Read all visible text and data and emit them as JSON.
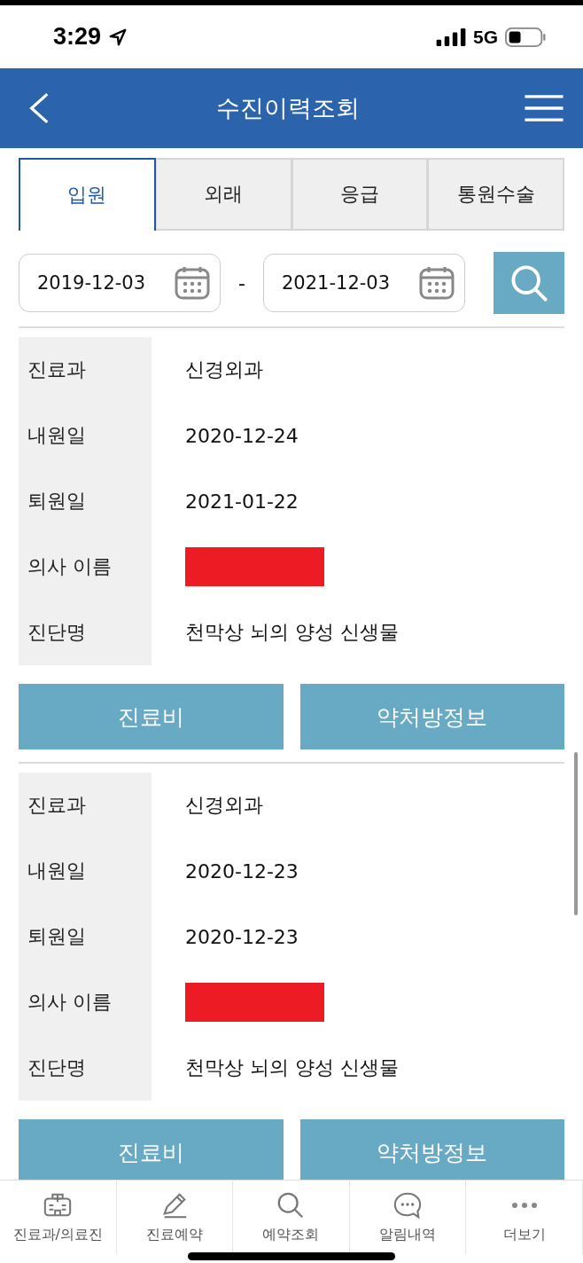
{
  "status_bar": {
    "time": "3:29",
    "network": "5G"
  },
  "header": {
    "title": "수진이력조회"
  },
  "tabs": [
    {
      "label": "입원",
      "selected": true
    },
    {
      "label": "외래",
      "selected": false
    },
    {
      "label": "응급",
      "selected": false
    },
    {
      "label": "통원수술",
      "selected": false
    }
  ],
  "date_range": {
    "from": "2019-12-03",
    "separator": "-",
    "to": "2021-12-03"
  },
  "records": [
    {
      "fields": [
        {
          "label": "진료과",
          "value": "신경외과"
        },
        {
          "label": "내원일",
          "value": "2020-12-24"
        },
        {
          "label": "퇴원일",
          "value": "2021-01-22"
        },
        {
          "label": "의사 이름",
          "redacted": true
        },
        {
          "label": "진단명",
          "value": "천막상 뇌의 양성 신생물"
        }
      ],
      "buttons": [
        "진료비",
        "약처방정보"
      ]
    },
    {
      "fields": [
        {
          "label": "진료과",
          "value": "신경외과"
        },
        {
          "label": "내원일",
          "value": "2020-12-23"
        },
        {
          "label": "퇴원일",
          "value": "2020-12-23"
        },
        {
          "label": "의사 이름",
          "redacted": true
        },
        {
          "label": "진단명",
          "value": "천막상 뇌의 양성 신생물"
        }
      ],
      "buttons": [
        "진료비",
        "약처방정보"
      ]
    }
  ],
  "bottom_nav": [
    {
      "label": "진료과/의료진"
    },
    {
      "label": "진료예약"
    },
    {
      "label": "예약조회"
    },
    {
      "label": "알림내역"
    },
    {
      "label": "더보기"
    }
  ]
}
